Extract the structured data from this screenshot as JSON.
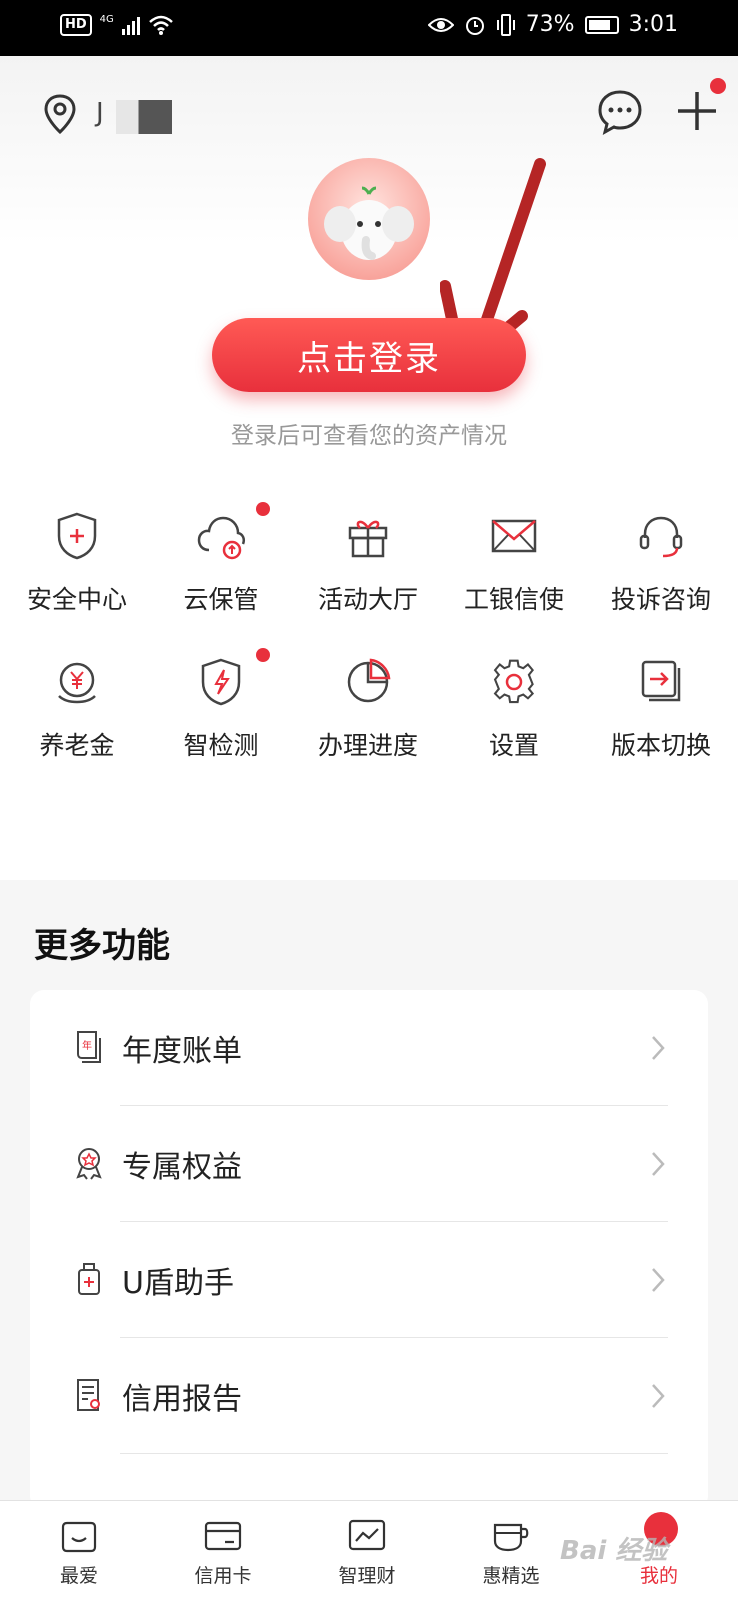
{
  "status_bar": {
    "hd": "HD",
    "network": "4G",
    "battery": "73%",
    "time": "3:01"
  },
  "header": {
    "user_name_visible": "J",
    "message_icon": "chat-bubble-icon",
    "add_icon": "plus-icon",
    "location_icon": "location-pin-icon"
  },
  "login": {
    "button_label": "点击登录",
    "hint": "登录后可查看您的资产情况"
  },
  "grid": {
    "items": [
      {
        "label": "安全中心",
        "icon": "shield-plus-icon"
      },
      {
        "label": "云保管",
        "icon": "cloud-upload-icon"
      },
      {
        "label": "活动大厅",
        "icon": "gift-icon"
      },
      {
        "label": "工银信使",
        "icon": "envelope-icon"
      },
      {
        "label": "投诉咨询",
        "icon": "headset-icon"
      },
      {
        "label": "养老金",
        "icon": "yuan-coin-icon"
      },
      {
        "label": "智检测",
        "icon": "shield-bolt-icon"
      },
      {
        "label": "办理进度",
        "icon": "pie-progress-icon"
      },
      {
        "label": "设置",
        "icon": "gear-icon"
      },
      {
        "label": "版本切换",
        "icon": "switch-arrow-icon"
      }
    ]
  },
  "more": {
    "title": "更多功能",
    "items": [
      {
        "label": "年度账单",
        "icon": "annual-bill-icon"
      },
      {
        "label": "专属权益",
        "icon": "ribbon-badge-icon"
      },
      {
        "label": "U盾助手",
        "icon": "usb-key-icon"
      },
      {
        "label": "信用报告",
        "icon": "credit-report-icon"
      }
    ]
  },
  "tabbar": {
    "items": [
      {
        "label": "最爱",
        "icon": "smile-box-icon",
        "active": false
      },
      {
        "label": "信用卡",
        "icon": "credit-card-icon",
        "active": false
      },
      {
        "label": "智理财",
        "icon": "trend-chart-icon",
        "active": false
      },
      {
        "label": "惠精选",
        "icon": "cup-icon",
        "active": false
      },
      {
        "label": "我的",
        "icon": "me-icon",
        "active": true
      }
    ]
  },
  "watermark": "Bai 经验",
  "colors": {
    "accent": "#e8303c",
    "text": "#222222",
    "hint": "#999999"
  }
}
